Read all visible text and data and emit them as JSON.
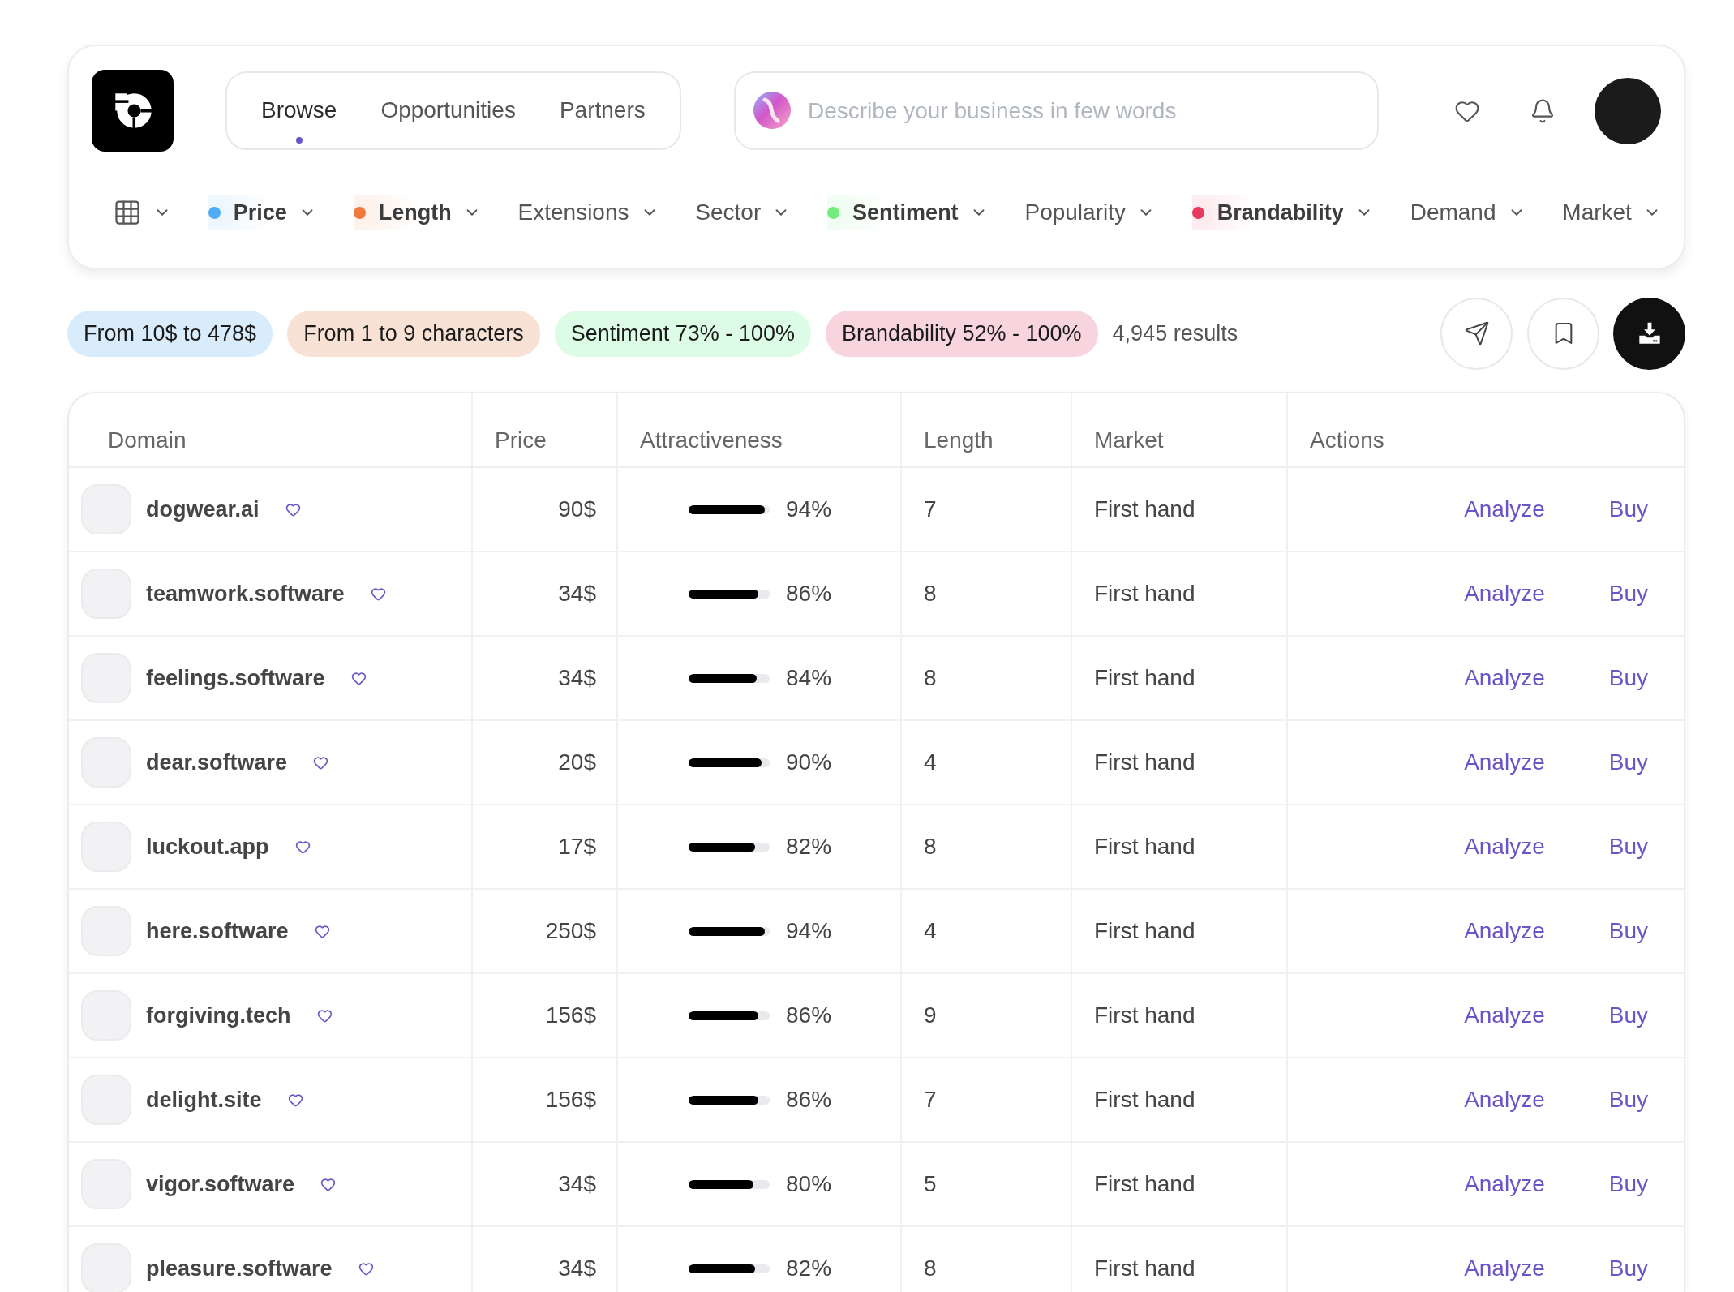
{
  "nav": {
    "tabs": [
      {
        "label": "Browse",
        "selected": true
      },
      {
        "label": "Opportunities",
        "selected": false
      },
      {
        "label": "Partners",
        "selected": false
      }
    ]
  },
  "search": {
    "placeholder": "Describe your business in few words"
  },
  "filters": [
    {
      "label": "Price",
      "active": true,
      "color": "#4fabf3"
    },
    {
      "label": "Length",
      "active": true,
      "color": "#ef7a3b"
    },
    {
      "label": "Extensions",
      "active": false
    },
    {
      "label": "Sector",
      "active": false
    },
    {
      "label": "Sentiment",
      "active": true,
      "color": "#73ec7d"
    },
    {
      "label": "Popularity",
      "active": false
    },
    {
      "label": "Brandability",
      "active": true,
      "color": "#e63b5f"
    },
    {
      "label": "Demand",
      "active": false
    },
    {
      "label": "Market",
      "active": false
    }
  ],
  "applied_filters": [
    {
      "label": "From 10$ to 478$",
      "color": "#d8ecfb"
    },
    {
      "label": "From 1 to 9 characters",
      "color": "#f8e2d5"
    },
    {
      "label": "Sentiment 73% - 100%",
      "color": "#dcfce5"
    },
    {
      "label": "Brandability 52% - 100%",
      "color": "#f8d4df"
    }
  ],
  "results": "4,945 results",
  "table": {
    "columns": [
      "Domain",
      "Price",
      "Attractiveness",
      "Length",
      "Market",
      "Actions"
    ],
    "rows": [
      {
        "domain": "dogwear.ai",
        "price": "90$",
        "attractiveness": {
          "level": 0.94,
          "reading": "94%"
        },
        "length": "7",
        "market": "First hand",
        "actions": [
          "Analyze",
          "Buy"
        ]
      },
      {
        "domain": "teamwork.software",
        "price": "34$",
        "attractiveness": {
          "level": 0.86,
          "reading": "86%"
        },
        "length": "8",
        "market": "First hand",
        "actions": [
          "Analyze",
          "Buy"
        ]
      },
      {
        "domain": "feelings.software",
        "price": "34$",
        "attractiveness": {
          "level": 0.84,
          "reading": "84%"
        },
        "length": "8",
        "market": "First hand",
        "actions": [
          "Analyze",
          "Buy"
        ]
      },
      {
        "domain": "dear.software",
        "price": "20$",
        "attractiveness": {
          "level": 0.9,
          "reading": "90%"
        },
        "length": "4",
        "market": "First hand",
        "actions": [
          "Analyze",
          "Buy"
        ]
      },
      {
        "domain": "luckout.app",
        "price": "17$",
        "attractiveness": {
          "level": 0.82,
          "reading": "82%"
        },
        "length": "8",
        "market": "First hand",
        "actions": [
          "Analyze",
          "Buy"
        ]
      },
      {
        "domain": "here.software",
        "price": "250$",
        "attractiveness": {
          "level": 0.94,
          "reading": "94%"
        },
        "length": "4",
        "market": "First hand",
        "actions": [
          "Analyze",
          "Buy"
        ]
      },
      {
        "domain": "forgiving.tech",
        "price": "156$",
        "attractiveness": {
          "level": 0.86,
          "reading": "86%"
        },
        "length": "9",
        "market": "First hand",
        "actions": [
          "Analyze",
          "Buy"
        ]
      },
      {
        "domain": "delight.site",
        "price": "156$",
        "attractiveness": {
          "level": 0.86,
          "reading": "86%"
        },
        "length": "7",
        "market": "First hand",
        "actions": [
          "Analyze",
          "Buy"
        ]
      },
      {
        "domain": "vigor.software",
        "price": "34$",
        "attractiveness": {
          "level": 0.8,
          "reading": "80%"
        },
        "length": "5",
        "market": "First hand",
        "actions": [
          "Analyze",
          "Buy"
        ]
      },
      {
        "domain": "pleasure.software",
        "price": "34$",
        "attractiveness": {
          "level": 0.82,
          "reading": "82%"
        },
        "length": "8",
        "market": "First hand",
        "actions": [
          "Analyze",
          "Buy"
        ]
      }
    ]
  }
}
